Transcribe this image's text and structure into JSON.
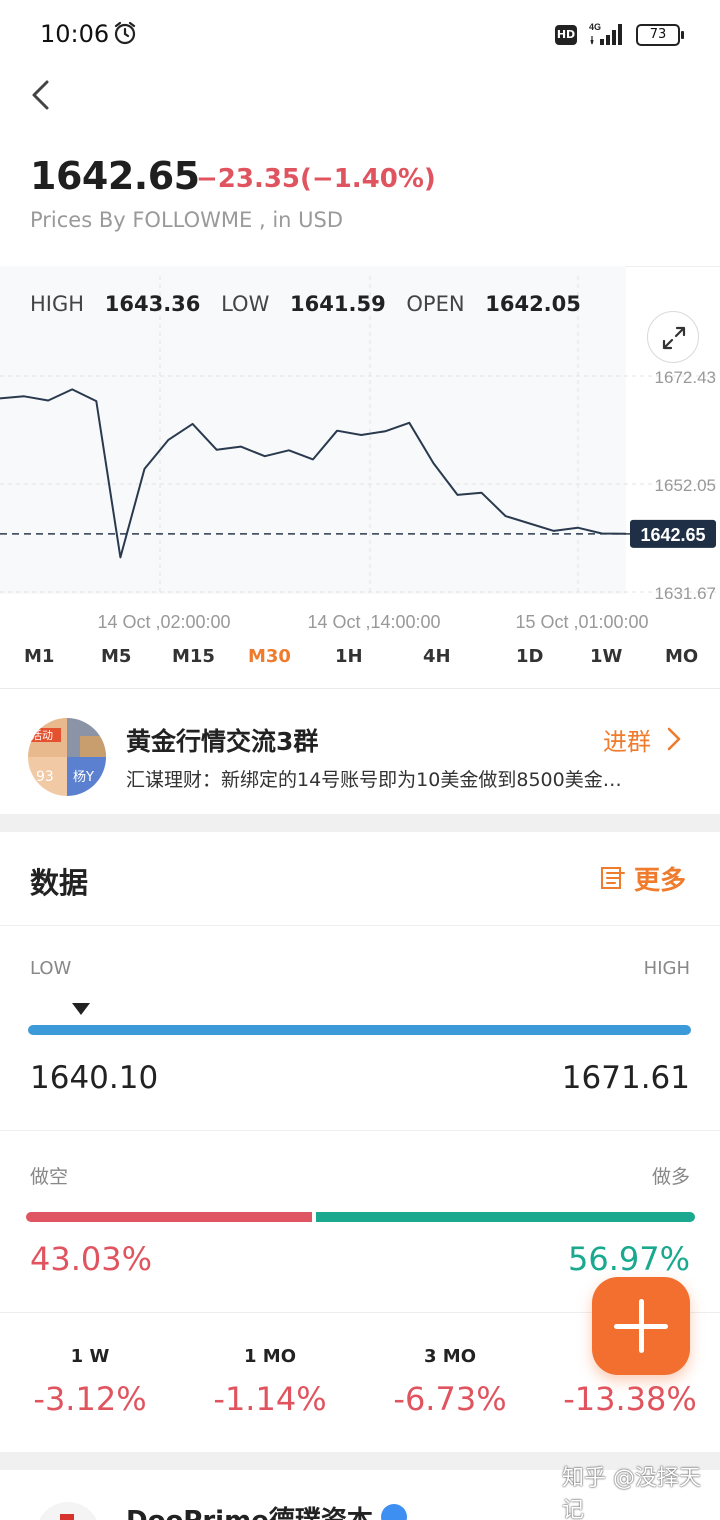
{
  "status_bar": {
    "time": "10:06",
    "network": "4G",
    "hd": "HD",
    "battery": "73"
  },
  "quote": {
    "price": "1642.65",
    "change": "−23.35(−1.40%)",
    "source": "Prices By FOLLOWME , in USD"
  },
  "stats": {
    "high_label": "HIGH",
    "high": "1643.36",
    "low_label": "LOW",
    "low": "1641.59",
    "open_label": "OPEN",
    "open": "1642.05"
  },
  "chart_data": {
    "type": "line",
    "x_tick_labels": [
      "14 Oct ,02:00:00",
      "14 Oct ,14:00:00",
      "15 Oct ,01:00:00"
    ],
    "y_tick_labels": [
      "1672.43",
      "1652.05",
      "1631.67"
    ],
    "ylim": [
      1631.67,
      1672.43
    ],
    "current_value_label": "1642.65",
    "current_value": 1642.65,
    "grid": true,
    "series": [
      {
        "values": [
          1668.2,
          1668.6,
          1667.8,
          1669.9,
          1667.7,
          1638.2,
          1654.9,
          1660.4,
          1663.4,
          1658.5,
          1659.1,
          1657.3,
          1658.4,
          1656.7,
          1662.1,
          1661.3,
          1662.0,
          1663.6,
          1656.0,
          1650.0,
          1650.4,
          1646.0,
          1644.6,
          1643.2,
          1643.8,
          1642.7,
          1642.65
        ]
      }
    ]
  },
  "periods": [
    {
      "label": "M1"
    },
    {
      "label": "M5"
    },
    {
      "label": "M15"
    },
    {
      "label": "M30"
    },
    {
      "label": "1H"
    },
    {
      "label": "4H"
    },
    {
      "label": "1D"
    },
    {
      "label": "1W"
    },
    {
      "label": "MO"
    }
  ],
  "active_period": "M30",
  "group": {
    "avatar_tag": "活动",
    "avatar_num": "93",
    "avatar_user": "杨Y",
    "name": "黄金行情交流3群",
    "message": "汇谋理财：新绑定的14号账号即为10美金做到8500美金…",
    "join_label": "进群"
  },
  "data_section": {
    "title": "数据",
    "more_label": "更多",
    "range": {
      "low_label": "LOW",
      "high_label": "HIGH",
      "low": "1640.10",
      "high": "1671.61",
      "marker_position": 0.08
    },
    "sentiment": {
      "short_label": "做空",
      "long_label": "做多",
      "short_pct": "43.03%",
      "long_pct": "56.97%",
      "short_fraction": 0.4303
    },
    "performance": [
      {
        "label": "1 W",
        "value": "-3.12%"
      },
      {
        "label": "1 MO",
        "value": "-1.14%"
      },
      {
        "label": "3 MO",
        "value": "-6.73%"
      },
      {
        "label": "",
        "value": "-13.38%"
      }
    ]
  },
  "next_item": {
    "name": "DooPrime德璞资本"
  },
  "watermark": "知乎 @没择天记",
  "colors": {
    "accent": "#ef7c2d",
    "down": "#e0545f",
    "up": "#1aa88f",
    "range_bar": "#3d9ad8",
    "line": "#2a3a4e"
  }
}
